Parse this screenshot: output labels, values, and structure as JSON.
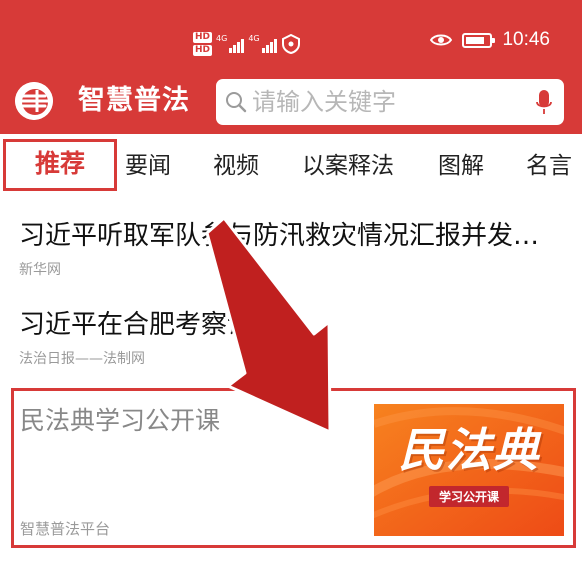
{
  "status_bar": {
    "hd_top": "HD",
    "hd_bottom": "HD",
    "network_1": "4G",
    "network_2": "4G",
    "time": "10:46",
    "battery_level": 0.65,
    "icons": [
      "hd-icon",
      "signal-icon",
      "hotspot-icon",
      "eye-comfort-icon",
      "battery-icon"
    ]
  },
  "header": {
    "app_title": "智慧普法",
    "search_placeholder": "请输入关键字",
    "brand_color": "#d73a38"
  },
  "tabs": [
    {
      "label": "推荐",
      "active": true
    },
    {
      "label": "要闻"
    },
    {
      "label": "视频"
    },
    {
      "label": "以案释法"
    },
    {
      "label": "图解"
    },
    {
      "label": "名言"
    }
  ],
  "news": [
    {
      "title": "习近平听取军队参与防汛救灾情况汇报并发表重要讲话",
      "source": "新华网"
    },
    {
      "title": "习近平在合肥考察调研",
      "source": "法治日报——法制网"
    }
  ],
  "featured": {
    "title": "民法典学习公开课",
    "source": "智慧普法平台",
    "thumbnail_title": "民法典",
    "thumbnail_badge": "学习公开课"
  },
  "annotation": {
    "highlight_color": "#d73a38",
    "arrow_color": "#c0201f"
  }
}
